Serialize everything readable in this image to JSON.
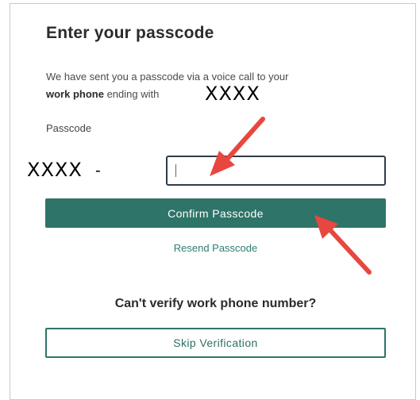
{
  "title": "Enter your passcode",
  "description": {
    "prefix": "We have sent you a passcode via a voice call to your",
    "bold": "work phone",
    "suffix": "ending with"
  },
  "redacted_phone": "XXXX",
  "passcode": {
    "label": "Passcode",
    "prefix": "XXXX",
    "separator": "-",
    "value": ""
  },
  "buttons": {
    "confirm": "Confirm Passcode",
    "resend": "Resend Passcode",
    "skip": "Skip Verification"
  },
  "subheading": "Can't verify work phone number?",
  "colors": {
    "accent": "#2e7468",
    "annotation_arrow": "#e8473f"
  }
}
